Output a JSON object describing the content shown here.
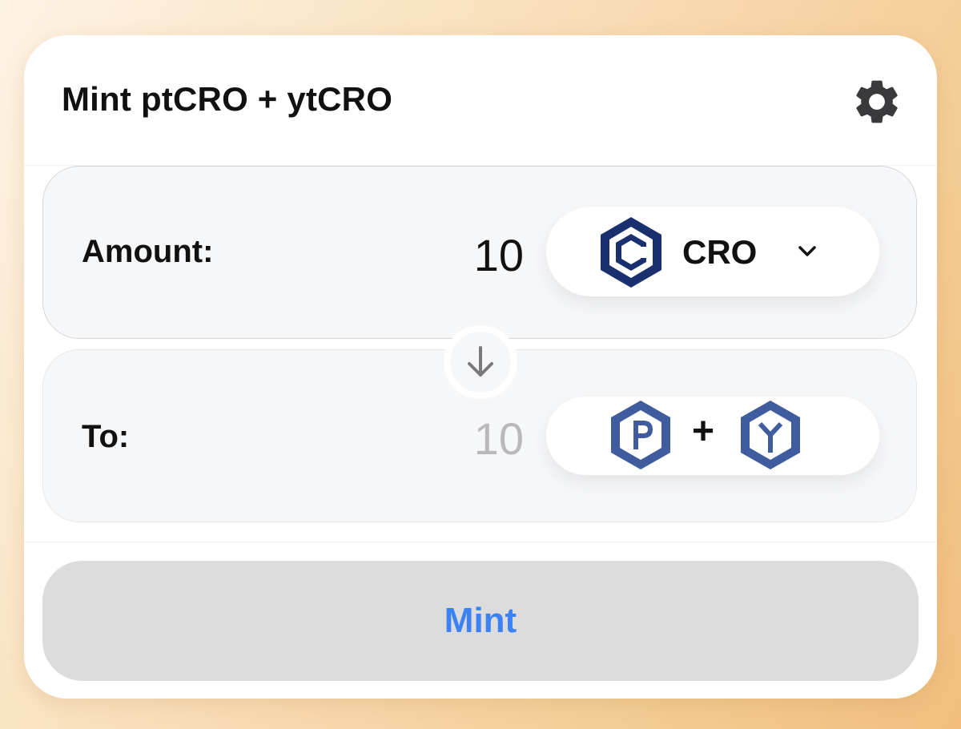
{
  "header": {
    "title": "Mint ptCRO + ytCRO",
    "settings_icon": "gear-icon"
  },
  "amount": {
    "label": "Amount:",
    "value": "10",
    "token": {
      "symbol": "CRO",
      "icon": "cro-token-icon",
      "dropdown_icon": "chevron-down-icon"
    }
  },
  "to": {
    "label": "To:",
    "value": "10",
    "tokens": {
      "first_icon": "pt-token-icon",
      "separator": "+",
      "second_icon": "yt-token-icon"
    }
  },
  "swap_icon": "arrow-down-icon",
  "mint_button": {
    "label": "Mint"
  },
  "colors": {
    "accent": "#3b82f6",
    "token_dark_blue": "#1a2f6e",
    "token_mid_blue": "#3e5c9e",
    "button_bg": "#dcdcdc",
    "panel_bg": "#f6f7f9"
  }
}
